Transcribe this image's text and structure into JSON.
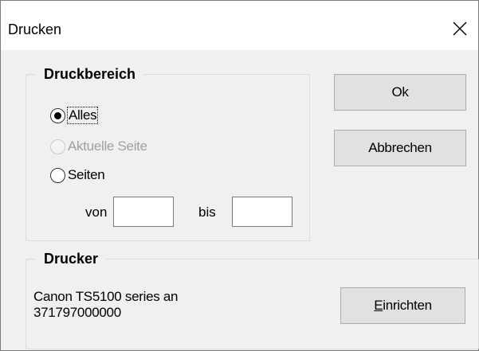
{
  "window": {
    "title": "Drucken",
    "close_icon": "close-icon"
  },
  "print_range": {
    "legend": "Druckbereich",
    "options": [
      {
        "label": "Alles",
        "checked": true,
        "enabled": true
      },
      {
        "label": "Aktuelle Seite",
        "checked": false,
        "enabled": false
      },
      {
        "label": "Seiten",
        "checked": false,
        "enabled": true
      }
    ],
    "from_label": "von",
    "from_value": "",
    "to_label": "bis",
    "to_value": ""
  },
  "buttons": {
    "ok": "Ok",
    "cancel": "Abbrechen"
  },
  "printer": {
    "legend": "Drucker",
    "name_line1": "Canon TS5100 series an",
    "name_line2": "371797000000",
    "setup_mnemonic": "E",
    "setup_rest": "inrichten"
  }
}
